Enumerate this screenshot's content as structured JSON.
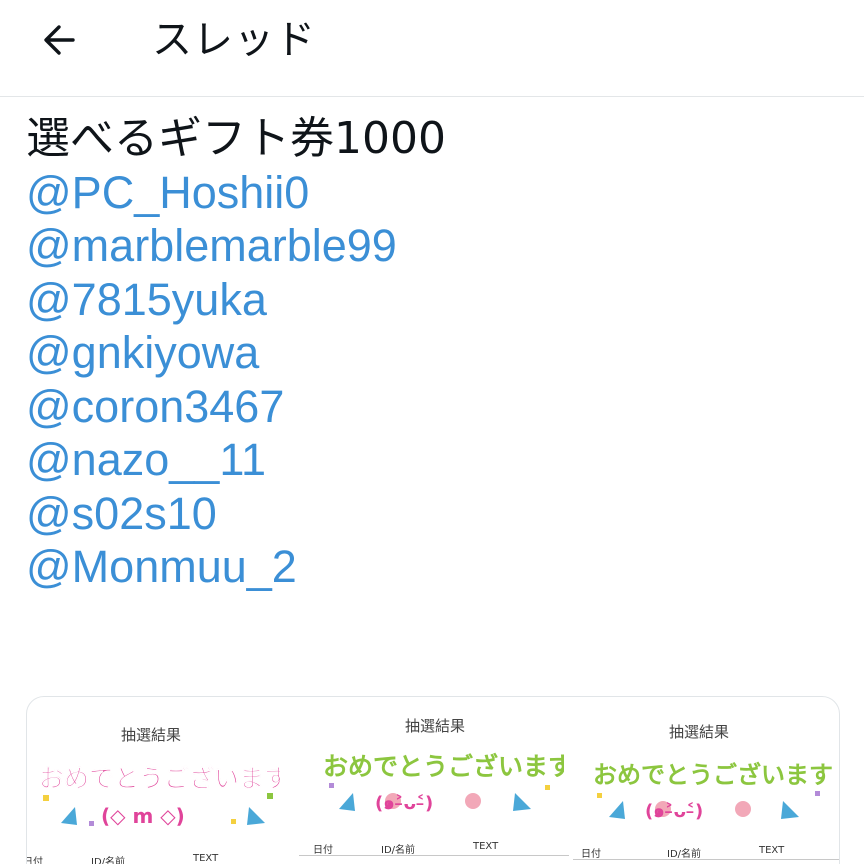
{
  "header": {
    "title": "スレッド",
    "back_icon": "arrow-left-icon"
  },
  "tweet": {
    "first_line": "選べるギフト券1000",
    "mentions": [
      "@PC_Hoshii0",
      "@marblemarble99",
      "@7815yuka",
      "@gnkiyowa",
      "@coron3467",
      "@nazo__11",
      "@s02s10",
      "@Monmuu_2"
    ]
  },
  "media": {
    "panels": [
      {
        "title": "抽選結果",
        "banner_text": "おめでとうございます",
        "face": "(◇ m ◇)",
        "col_date": "日付",
        "col_id": "ID/名前",
        "col_text": "TEXT"
      },
      {
        "title": "抽選結果",
        "banner_text": "おめでとうございます",
        "face": "(๑˃̵ᴗ˂̵)",
        "col_date": "日付",
        "col_id": "ID/名前",
        "col_text": "TEXT"
      },
      {
        "title": "抽選結果",
        "banner_text": "おめでとうございます",
        "face": "(๑˃̵ᴗ˂̵)",
        "col_date": "日付",
        "col_id": "ID/名前",
        "col_text": "TEXT"
      }
    ]
  },
  "colors": {
    "mention": "#3b8fd6",
    "text": "#0f1419",
    "banner_pink": "#e0449a",
    "banner_green": "#8cc63f",
    "banner_blue": "#4aa8d8"
  }
}
